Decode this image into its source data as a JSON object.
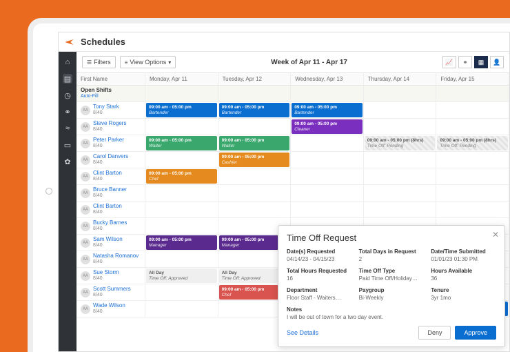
{
  "page": {
    "title": "Schedules"
  },
  "toolbar": {
    "filters_label": "Filters",
    "view_options_label": "View Options",
    "week_label": "Week of Apr 11 - Apr 17"
  },
  "columns": {
    "name_header": "First Name",
    "days": [
      "Monday, Apr 11",
      "Tuesday, Apr 12",
      "Wednesday, Apr 13",
      "Thursday, Apr 14",
      "Friday, Apr 15"
    ]
  },
  "open_shifts": {
    "label": "Open Shifts",
    "sub": "Auto-Fill"
  },
  "shift_defaults": {
    "time": "09:00 am - 05:00 pm"
  },
  "roles": {
    "bartender": "Bartender",
    "cleaner": "Cleaner",
    "waiter": "Waiter",
    "cashier": "Cashier",
    "chef": "Chef",
    "manager": "Manager"
  },
  "timeoff_cell": {
    "time": "09:00 am - 05:00 pm (8hrs)",
    "sub": "Time Off: Pending"
  },
  "allday_cell": {
    "time": "All Day",
    "sub": "Time Off: Approved"
  },
  "employees": [
    {
      "name": "Tony Stark",
      "sub": "8/40"
    },
    {
      "name": "Steve Rogers",
      "sub": "8/40"
    },
    {
      "name": "Peter Parker",
      "sub": "8/40"
    },
    {
      "name": "Carol Danvers",
      "sub": "8/40"
    },
    {
      "name": "Clint Barton",
      "sub": "8/40"
    },
    {
      "name": "Bruce Banner",
      "sub": "8/40"
    },
    {
      "name": "Clint Barton",
      "sub": "8/40"
    },
    {
      "name": "Bucky Barnes",
      "sub": "8/40"
    },
    {
      "name": "Sam Wilson",
      "sub": "8/40"
    },
    {
      "name": "Natasha Romanov",
      "sub": "8/40"
    },
    {
      "name": "Sue Storm",
      "sub": "8/40"
    },
    {
      "name": "Scott Summers",
      "sub": "8/40"
    },
    {
      "name": "Wade Wilson",
      "sub": "8/40"
    }
  ],
  "panel": {
    "title": "Time Off Request",
    "fields": {
      "dates_label": "Date(s) Requested",
      "dates_val": "04/14/23 - 04/15/23",
      "total_days_label": "Total Days in Request",
      "total_days_val": "2",
      "submitted_label": "Date/Time Submitted",
      "submitted_val": "01/01/23 01:30 PM",
      "hours_req_label": "Total Hours Requested",
      "hours_req_val": "16",
      "type_label": "Time Off Type",
      "type_val": "Paid Time Off/Holiday…",
      "hours_avail_label": "Hours Available",
      "hours_avail_val": "36",
      "dept_label": "Department",
      "dept_val": "Floor Staff - Waiters…",
      "paygroup_label": "Paygroup",
      "paygroup_val": "Bi-Weekly",
      "tenure_label": "Tenure",
      "tenure_val": "3yr 1mo"
    },
    "notes_label": "Notes",
    "notes_val": "I will be out of town for a two day event.",
    "see_details": "See Details",
    "deny": "Deny",
    "approve": "Approve"
  }
}
